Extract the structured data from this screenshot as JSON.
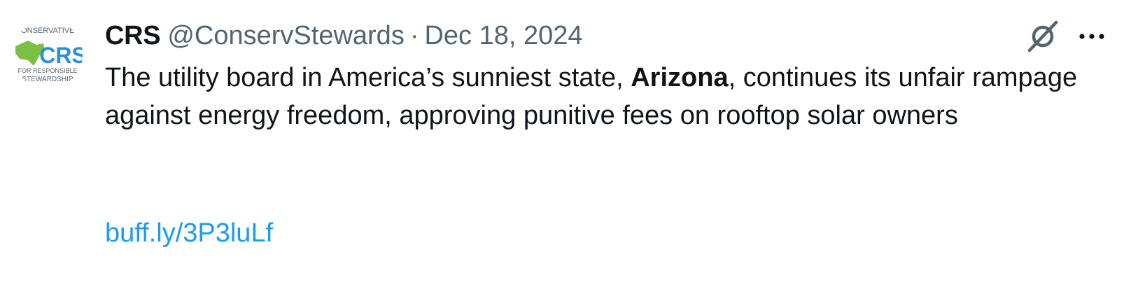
{
  "tweet": {
    "display_name": "CRS",
    "handle": "@ConservStewards",
    "separator": "·",
    "date": "Dec 18, 2024",
    "text_part1": "The utility board in America’s sunniest state, ",
    "text_bold": "Arizona",
    "text_part2": ", continues its unfair rampage against energy freedom, approving punitive fees on rooftop solar owners",
    "link": "buff.ly/3P3luLf"
  },
  "avatar": {
    "line_top": "CONSERVATIVES",
    "logo_text": "CRS",
    "line_mid": "FOR RESPONSIBLE",
    "line_bottom": "STEWARDSHIP"
  },
  "icons": {
    "grok": "grok-icon",
    "more": "more-icon"
  },
  "colors": {
    "text": "#0f1419",
    "secondary": "#536471",
    "link": "#1d9bf0",
    "logo_blue": "#2a8fd8",
    "logo_green": "#7ac143"
  }
}
